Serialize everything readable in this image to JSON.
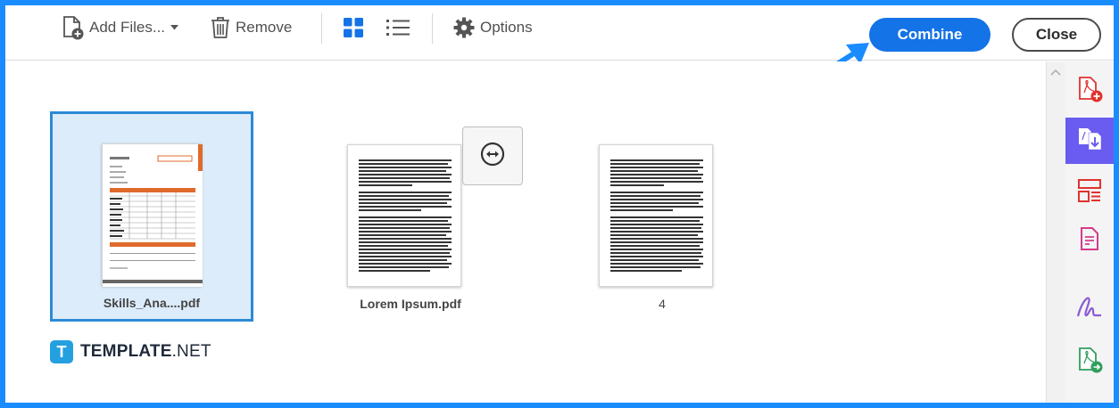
{
  "toolbar": {
    "add_files": {
      "label": "Add Files...",
      "icon": "add-file-icon"
    },
    "remove": {
      "label": "Remove",
      "icon": "trash-icon"
    },
    "view_grid_icon": "grid-view-icon",
    "view_list_icon": "list-view-icon",
    "options": {
      "label": "Options",
      "icon": "gear-icon"
    },
    "combine_label": "Combine",
    "close_label": "Close"
  },
  "files": [
    {
      "name": "Skills_Ana....pdf",
      "selected": true
    },
    {
      "name": "Lorem Ipsum.pdf",
      "selected": false
    },
    {
      "name": "4",
      "selected": false
    }
  ],
  "merge_button_icon": "expand-pages-icon",
  "logo": {
    "mark": "T",
    "brand": "TEMPLATE",
    "suffix": ".NET"
  },
  "rail_icons": [
    "create-pdf-icon",
    "combine-files-icon",
    "organize-pages-icon",
    "edit-pdf-icon",
    "fill-sign-icon",
    "export-pdf-icon"
  ],
  "colors": {
    "frame": "#1a8cff",
    "primary_button": "#1473e6",
    "selected_tile": "#dcecfb",
    "rail_active": "#6a5cf0",
    "pdf_red": "#e0322d"
  }
}
